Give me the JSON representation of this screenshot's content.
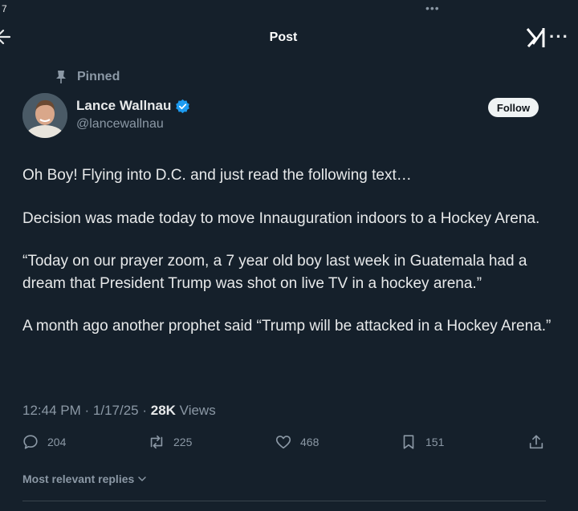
{
  "status_bar": {
    "left_text": "7"
  },
  "header": {
    "title": "Post",
    "back_icon": "back-arrow-icon",
    "grok_icon": "grok-icon",
    "more_icon": "more-icon"
  },
  "pinned": {
    "label": "Pinned",
    "icon": "pin-icon"
  },
  "author": {
    "name": "Lance Wallnau",
    "handle": "@lancewallnau",
    "verified_color": "#1d9bf0",
    "follow_label": "Follow"
  },
  "tweet": {
    "paragraphs": [
      "Oh Boy! Flying into D.C. and just read the following text…",
      "Decision was made today to move Innauguration indoors to a Hockey Arena.",
      "“Today on our  prayer zoom, a 7 year old boy last week in Guatemala had a dream that President Trump was shot on live TV in a hockey arena.”",
      "A month ago another prophet said “Trump will be attacked in a Hockey Arena.”"
    ]
  },
  "meta": {
    "time": "12:44 PM",
    "date": "1/17/25",
    "views_count": "28K",
    "views_label": "Views"
  },
  "actions": {
    "replies": "204",
    "reposts": "225",
    "likes": "468",
    "bookmarks": "151"
  },
  "replies_sort": {
    "label": "Most relevant replies"
  },
  "colors": {
    "background": "#15202b",
    "text": "#e7e9ea",
    "muted": "#8b98a5",
    "accent": "#1d9bf0"
  }
}
